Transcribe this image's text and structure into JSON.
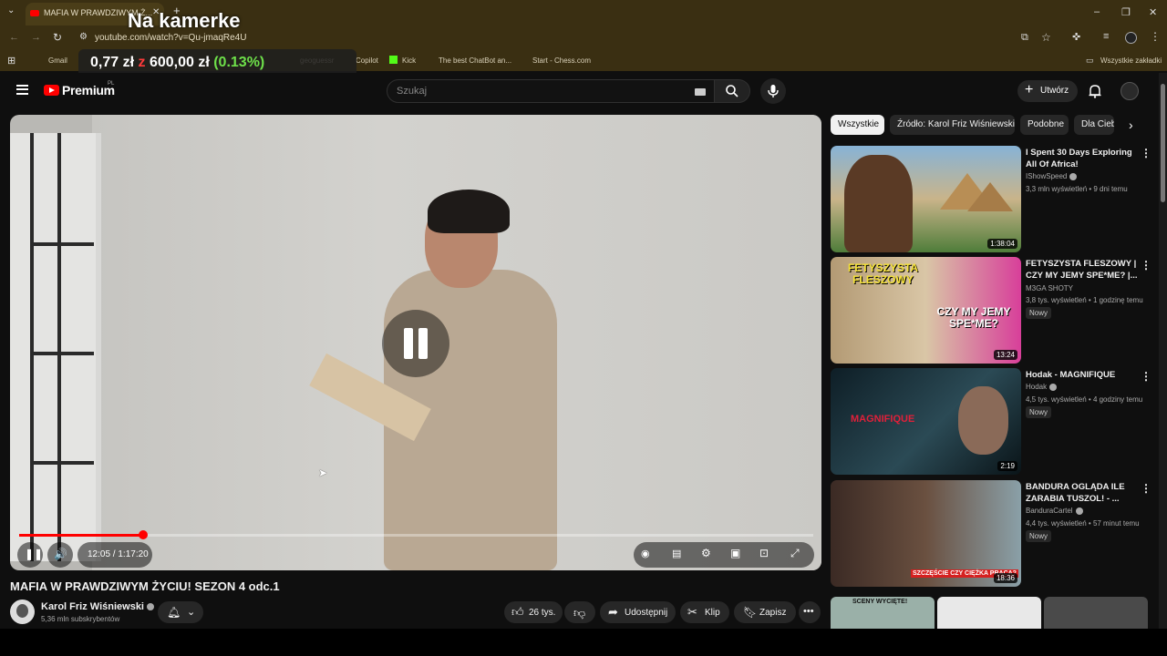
{
  "browser": {
    "tab_title": "MAFIA W PRAWDZIWYM Ż...",
    "url": "youtube.com/watch?v=Qu-jmaqRe4U",
    "bookmarks": [
      "Gmail",
      "geoguessr",
      "Copilot",
      "Kick",
      "The best ChatBot an...",
      "Start - Chess.com"
    ],
    "all_bookmarks": "Wszystkie zakładki"
  },
  "overlay": {
    "title": "Na kamerke",
    "price_a": "0,77 zł",
    "price_of": "z",
    "price_b": "600,00 zł",
    "price_pct": "(0.13%)"
  },
  "header": {
    "brand": "Premium",
    "region": "PL",
    "search_placeholder": "Szukaj",
    "create_label": "Utwórz"
  },
  "player": {
    "time": "12:05 / 1:17:20",
    "progress": 0.156
  },
  "video": {
    "title": "MAFIA W PRAWDZIWYM ŻYCIU! SEZON 4 odc.1",
    "channel": "Karol Friz Wiśniewski",
    "subscribers": "5,36 mln subskrybentów",
    "likes": "26 tys.",
    "share": "Udostępnij",
    "clip": "Klip",
    "save": "Zapisz"
  },
  "chips": [
    "Wszystkie",
    "Źródło: Karol Friz Wiśniewski",
    "Podobne",
    "Dla Ciebie"
  ],
  "recommendations": [
    {
      "title": "I Spent 30 Days Exploring All Of Africa!",
      "channel": "IShowSpeed",
      "meta": "3,3 mln wyświetleń • 9 dni temu",
      "duration": "1:38:04",
      "badge": ""
    },
    {
      "title": "FETYSZYSTA FLESZOWY | CZY MY JEMY SPE*ME? |...",
      "channel": "M3GA SHOTY",
      "meta": "3,8 tys. wyświetleń • 1 godzinę temu",
      "duration": "13:24",
      "badge": "Nowy"
    },
    {
      "title": "Hodak - MAGNIFIQUE",
      "channel": "Hodak",
      "meta": "4,5 tys. wyświetleń • 4 godziny temu",
      "duration": "2:19",
      "badge": "Nowy"
    },
    {
      "title": "BANDURA OGLĄDA ILE ZARABIA TUSZOL! - ...",
      "channel": "BanduraCartel",
      "meta": "4,4 tys. wyświetleń • 57 minut temu",
      "duration": "18:36",
      "badge": "Nowy"
    }
  ],
  "thumb_texts": {
    "t2": "FETYSZYSTA FLESZOWY",
    "t2b": "CZY MY JEMY SPE*ME?",
    "t3": "MAGNIFIQUE",
    "t4": "SZCZĘŚCIE CZY CIĘŻKA PRACA?",
    "s1": "SCENY WYCIĘTE!"
  }
}
